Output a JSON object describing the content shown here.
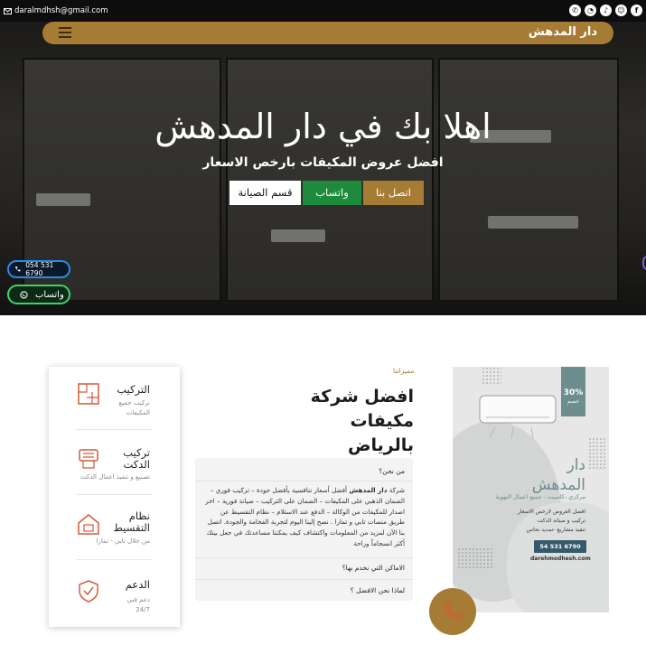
{
  "topbar": {
    "email": "daralmdhsh@gmail.com",
    "social_icons": [
      "phone-icon",
      "whatsapp-icon",
      "tiktok-icon",
      "snapchat-icon",
      "facebook-icon"
    ]
  },
  "nav": {
    "brand": "دار المدهش"
  },
  "hero": {
    "title": "اهلا بك في دار المدهش",
    "subtitle": "افضل عروض المكيفات بارخص الاسعار",
    "buttons": {
      "call": "اتصل بنا",
      "whatsapp": "واتساب",
      "maintenance": "قسم الصيانة"
    }
  },
  "floating": {
    "phone": "054 531 6790",
    "whatsapp": "واتساب"
  },
  "about": {
    "tag": "مميزاتنا",
    "heading_line1": "افضل شركة",
    "heading_line2": "مكيفات بالرياض",
    "accordion": {
      "q1": "من نحن؟",
      "body_lead": "شركة",
      "body_strong": "دار المدهش",
      "body_rest": "أفضل أسعار تنافسية بأفضل جودة – تركيب فوري – الضمان الذهبي على المكيفات – الضمان على التركيب – صيانة فورية – اخر اصدار للمكيفات من الوكالة – الدفع عند الاستلام – نظام التقسيط عن طريق منصات تابي و تمارا . نصح إلينا اليوم لتجربة الفخامة والجودة. اتصل بنا الآن لمزيد من المعلومات واكتشاف كيف يمكننا مساعدتك في جعل بيتك أكثر انسجاماً وراحة",
      "q2": "الاماكن التي نخدم بها؟",
      "q3": "لماذا نحن الافضل ؟"
    }
  },
  "services": [
    {
      "title": "التركيب",
      "desc": "تركيب جميع المكيفات",
      "icon": "blueprint-icon"
    },
    {
      "title": "تركيب الدكت",
      "desc": "تصنيع و تنفيذ اعمال الدكت",
      "icon": "duct-icon"
    },
    {
      "title": "نظام التقسيط",
      "desc": "من خلال تابي - تمارا",
      "icon": "house-payment-icon"
    },
    {
      "title": "الدعم",
      "desc": "دعم فني 24/7",
      "icon": "shield-support-icon"
    }
  ],
  "poster": {
    "discount": "30%",
    "discount_label": "خصم",
    "name_line1": "دار",
    "name_line2": "المدهش",
    "tagline": "مركزي -كاسيت - جميع اعمال التهوية",
    "bullets": [
      "افضل العروض لارخص الاسعار",
      "تركيب و صيانة الدكت",
      "تنفيذ مشاريع -تمديد نحاس"
    ],
    "phone": "54 531 6790",
    "site": "darehmodhesh.com"
  },
  "colors": {
    "brand": "#a67c35",
    "whatsapp": "#1e8b3c",
    "poster_accent": "#6d8d8e"
  }
}
